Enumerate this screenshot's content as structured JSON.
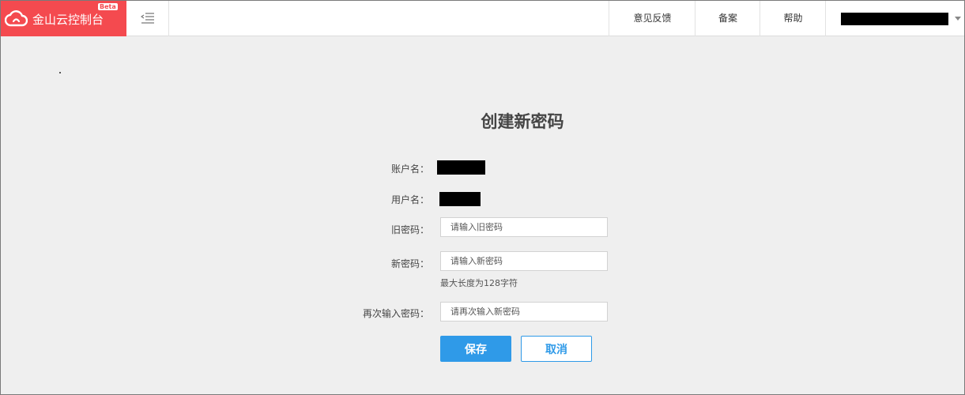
{
  "header": {
    "brand_title": "金山云控制台",
    "brand_badge": "Beta",
    "nav": {
      "feedback": "意见反馈",
      "record": "备案",
      "help": "帮助"
    }
  },
  "form": {
    "title": "创建新密码",
    "account_label": "账户名：",
    "username_label": "用户名：",
    "old_password": {
      "label": "旧密码：",
      "placeholder": "请输入旧密码",
      "value": ""
    },
    "new_password": {
      "label": "新密码：",
      "placeholder": "请输入新密码",
      "value": "",
      "hint": "最大长度为128字符"
    },
    "confirm_password": {
      "label": "再次输入密码：",
      "placeholder": "请再次输入新密码",
      "value": ""
    },
    "save_label": "保存",
    "cancel_label": "取消"
  },
  "colors": {
    "brand": "#f44a4f",
    "primary": "#2f9ae8",
    "background": "#efefef"
  },
  "icons": {
    "brand": "cloud-icon",
    "menu": "menu-collapse-icon",
    "user_menu": "caret-down-icon"
  }
}
